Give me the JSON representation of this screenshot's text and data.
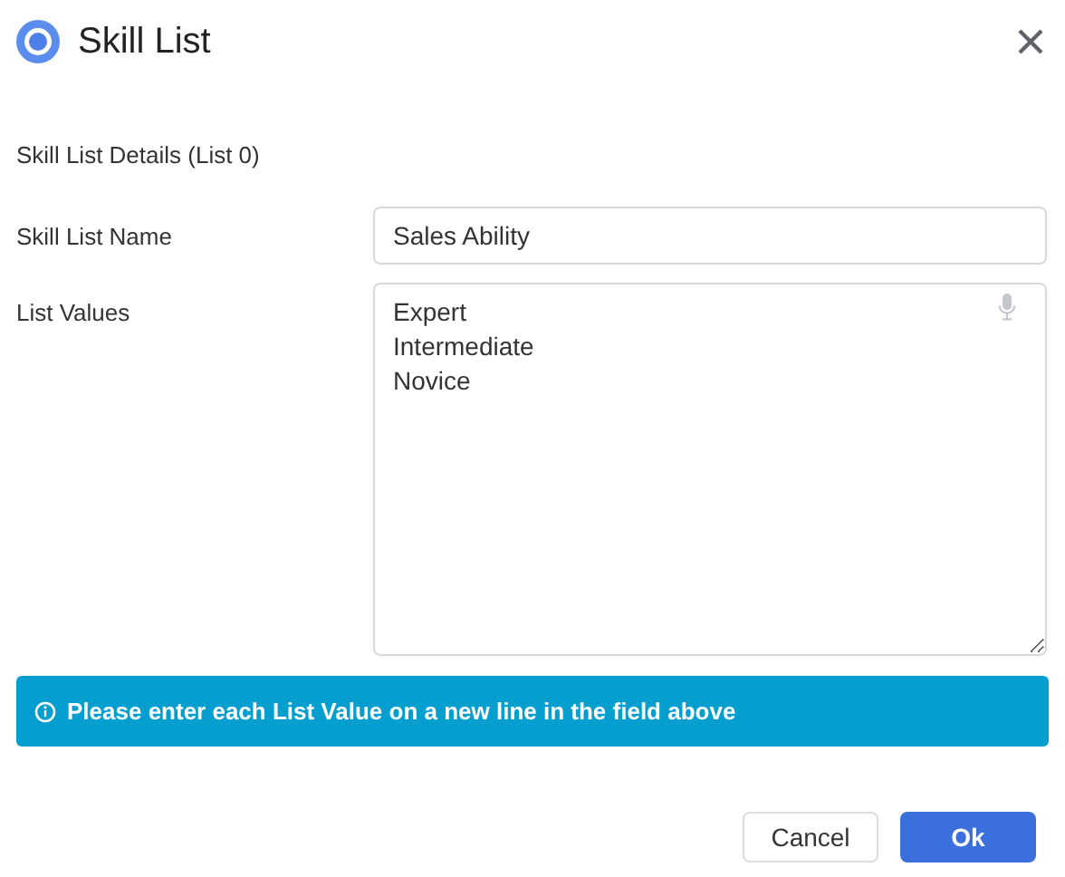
{
  "window": {
    "title": "Skill List"
  },
  "section_title": "Skill List Details (List 0)",
  "fields": [
    {
      "kind": "input",
      "label": "Skill List Name",
      "value": "Sales Ability"
    },
    {
      "kind": "textarea",
      "label": "List Values",
      "values": [
        "Expert",
        "Intermediate",
        "Novice"
      ]
    }
  ],
  "info_banner": "Please enter each List Value on a new line in the field above",
  "buttons": [
    {
      "label": "Cancel",
      "kind": "secondary"
    },
    {
      "label": "Ok",
      "kind": "primary"
    }
  ]
}
